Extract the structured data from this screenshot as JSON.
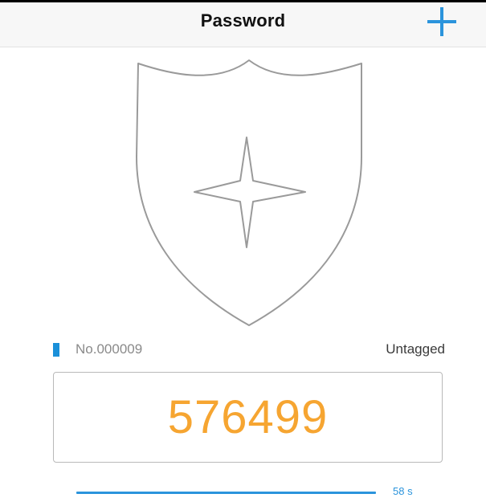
{
  "header": {
    "title": "Password",
    "add_icon": "plus-icon"
  },
  "shield": {
    "icon": "shield-star-icon",
    "stroke_color": "#9a9a9a"
  },
  "token": {
    "serial": "No.000009",
    "tag": "Untagged",
    "tag_color": "#1a90d9",
    "code": "576499",
    "code_color": "#f6a531"
  },
  "timer": {
    "remaining_label": "58 s",
    "remaining_fraction": 0.97,
    "color": "#2b94dc"
  }
}
